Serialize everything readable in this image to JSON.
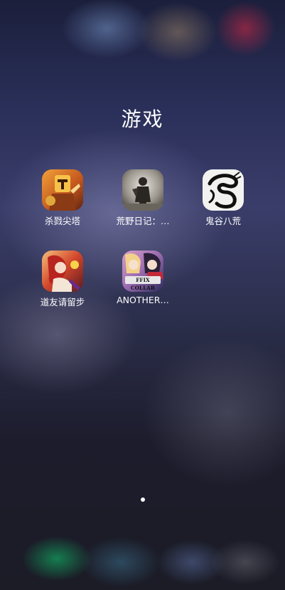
{
  "folder": {
    "title": "游戏"
  },
  "apps": [
    {
      "label": "杀戮尖塔",
      "icon": "slay-the-spire-icon"
    },
    {
      "label": "荒野日记：…",
      "icon": "wilderness-diary-icon"
    },
    {
      "label": "鬼谷八荒",
      "icon": "guigu-bahuang-icon"
    },
    {
      "label": "道友请留步",
      "icon": "daoyou-qingliubu-icon"
    },
    {
      "label": "ANOTHER…",
      "icon": "another-eden-icon",
      "badge_text": "FFIX COLLAB"
    }
  ],
  "pagination": {
    "current_page": 1,
    "total_pages": 1
  }
}
